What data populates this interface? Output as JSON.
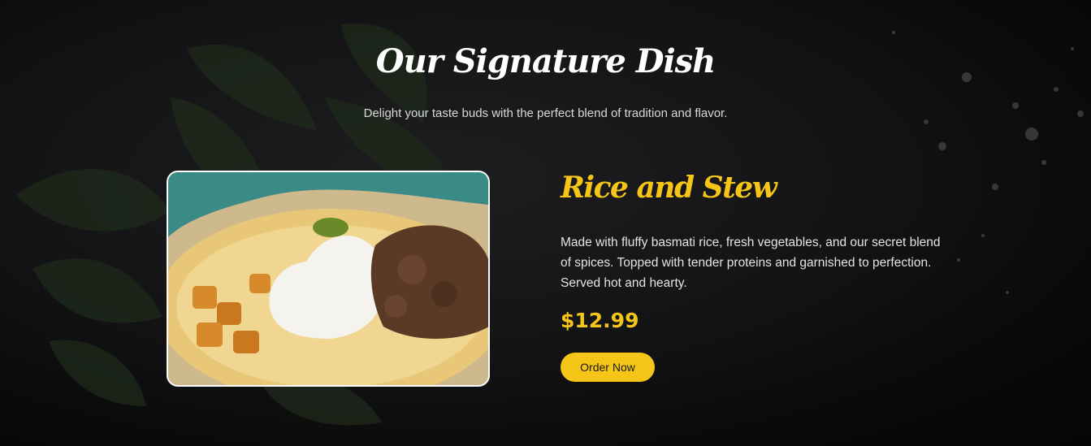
{
  "section": {
    "title": "Our Signature Dish",
    "subtitle": "Delight your taste buds with the perfect blend of tradition and flavor."
  },
  "dish": {
    "name": "Rice and Stew",
    "description": "Made with fluffy basmati rice, fresh vegetables, and our secret blend of spices. Topped with tender proteins and garnished to perfection. Served hot and hearty.",
    "price": "$12.99",
    "image_icon": "rice-and-stew-photo"
  },
  "actions": {
    "order_label": "Order Now"
  },
  "colors": {
    "accent": "#f5c518",
    "background": "#141416",
    "text": "#ffffff"
  }
}
